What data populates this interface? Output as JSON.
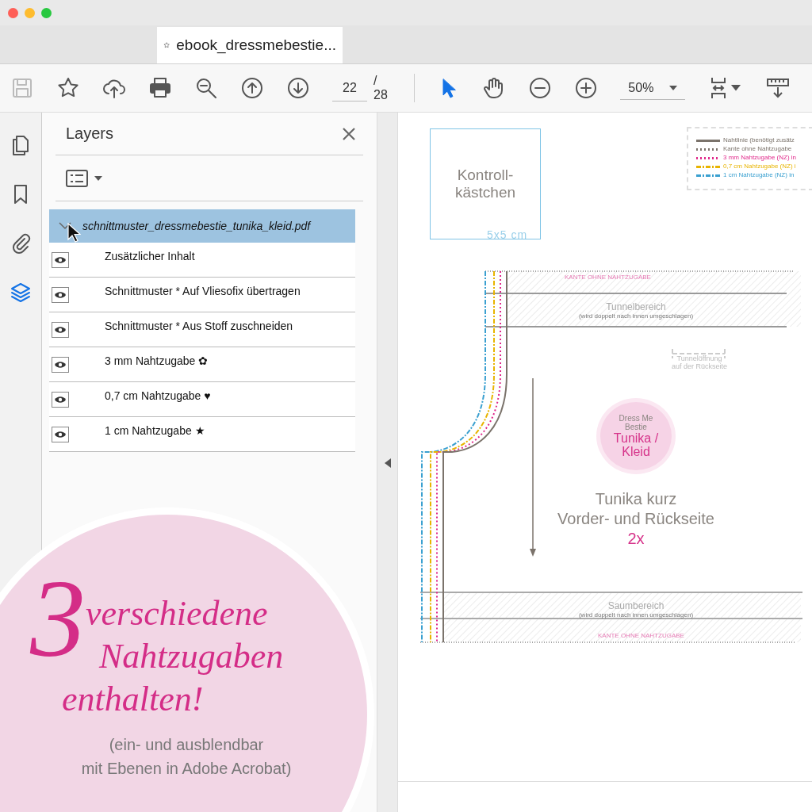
{
  "tab": {
    "title": "ebook_dressmebestie..."
  },
  "toolbar": {
    "tools": [
      {
        "kind": "save",
        "disabled": true,
        "selected": false
      },
      {
        "kind": "bookmark-star",
        "disabled": false,
        "selected": false
      },
      {
        "kind": "upload",
        "disabled": false,
        "selected": false
      },
      {
        "kind": "print",
        "disabled": false,
        "selected": false
      },
      {
        "kind": "zoom-search",
        "disabled": false,
        "selected": false
      },
      {
        "kind": "page-up",
        "disabled": false,
        "selected": false
      },
      {
        "kind": "page-down",
        "disabled": false,
        "selected": false
      }
    ],
    "page_current": "22",
    "page_total": "/ 28",
    "view_tools": [
      {
        "kind": "pointer",
        "disabled": false,
        "selected": true
      },
      {
        "kind": "hand",
        "disabled": false,
        "selected": false
      },
      {
        "kind": "zoom-out",
        "disabled": false,
        "selected": false
      },
      {
        "kind": "zoom-in",
        "disabled": false,
        "selected": false
      }
    ],
    "zoom": "50%"
  },
  "rail": [
    {
      "kind": "pages",
      "selected": false
    },
    {
      "kind": "bookmarks",
      "selected": false
    },
    {
      "kind": "attachments",
      "selected": false
    },
    {
      "kind": "layers",
      "selected": true
    }
  ],
  "layers_panel": {
    "title": "Layers",
    "document": {
      "name": "schnittmuster_dressmebestie_tunika_kleid.pdf",
      "expanded": true,
      "selected": true
    },
    "layers": [
      {
        "name": "Zusätzlicher Inhalt",
        "visible": true
      },
      {
        "name": "Schnittmuster * Auf Vliesofix übertragen",
        "visible": true
      },
      {
        "name": "Schnittmuster * Aus Stoff zuschneiden",
        "visible": true
      },
      {
        "name": "3 mm Nahtzugabe ✿",
        "visible": true
      },
      {
        "name": "0,7 cm Nahtzugabe ♥",
        "visible": true
      },
      {
        "name": "1 cm Nahtzugabe ★",
        "visible": true
      }
    ]
  },
  "page": {
    "control_box": {
      "lines": [
        "Kontroll-",
        "kästchen"
      ],
      "size": "5x5 cm"
    },
    "legend": [
      {
        "kind": "solid",
        "color": "#7b736b",
        "label": "Nahtlinie (benötigt zusätz"
      },
      {
        "kind": "dotted",
        "color": "#7b736b",
        "label": "Kante ohne Nahtzugabe"
      },
      {
        "kind": "dotted",
        "color": "#e0288a",
        "label": "3 mm Nahtzugabe (NZ) in"
      },
      {
        "kind": "dashdot",
        "color": "#e8b400",
        "label": "0,7 cm Nahtzugabe (NZ) i"
      },
      {
        "kind": "dashdot",
        "color": "#3aa0d0",
        "label": "1 cm Nahtzugabe (NZ) in"
      }
    ],
    "top_edge": "KANTE OHNE NAHTZUGABE",
    "tunnel": {
      "title": "Tunnelbereich",
      "note": "(wird doppelt nach innen umgeschlagen)"
    },
    "tunnel_opening": {
      "lines": [
        "Tunnelöffnung",
        "auf der Rückseite"
      ]
    },
    "badge": {
      "brand_lines": [
        "Dress Me",
        "Bestie"
      ],
      "name_lines": [
        "Tunika /",
        "Kleid"
      ]
    },
    "piece": {
      "title": "Tunika kurz",
      "subtitle": "Vorder- und Rückseite",
      "count": "2x"
    },
    "hem": {
      "title": "Saumbereich",
      "note": "(wird doppelt nach innen umgeschlagen)"
    },
    "bottom_edge": "KANTE OHNE NAHTZUGABE"
  },
  "promo": {
    "number": "3",
    "lines": [
      "verschiedene",
      "Nahtzugaben",
      "enthalten!"
    ],
    "note": [
      "(ein- und ausblendbar",
      "mit Ebenen in Adobe Acrobat)"
    ]
  }
}
